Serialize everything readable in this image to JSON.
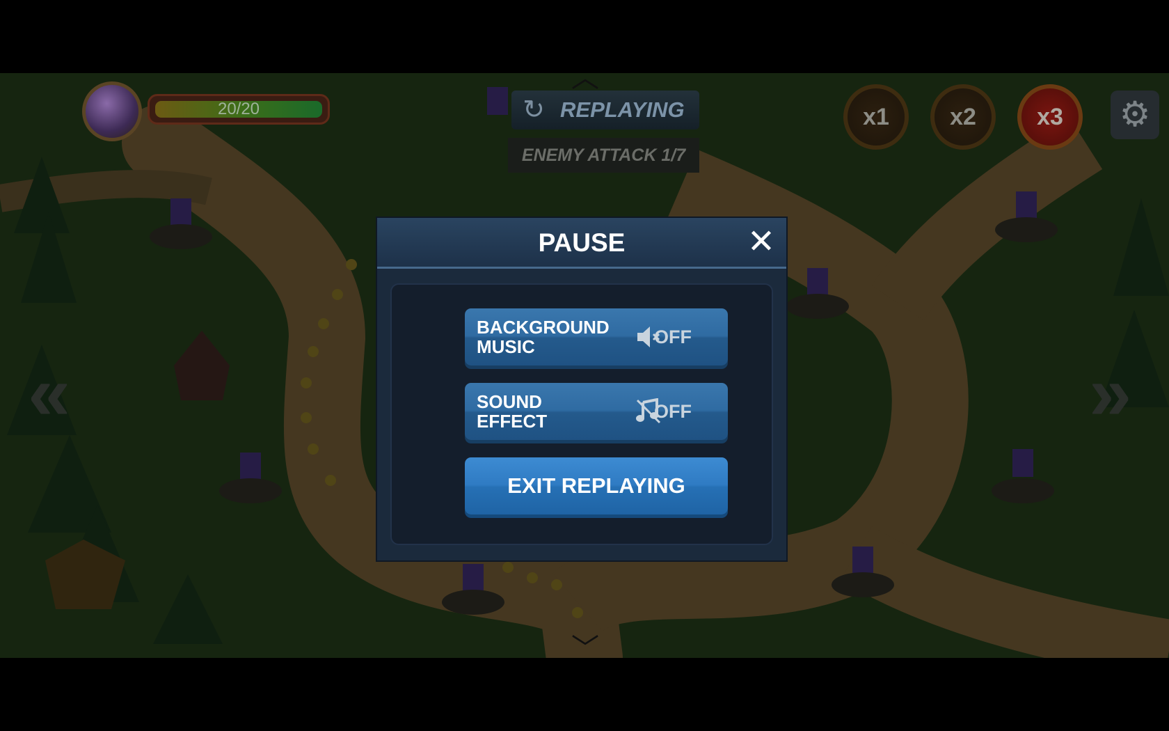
{
  "hud": {
    "castle_hp": "20/20",
    "replay_label": "REPLAYING",
    "enemy_attack": "ENEMY ATTACK 1/7",
    "speeds": [
      "x1",
      "x2",
      "x3"
    ],
    "active_speed": "x3"
  },
  "dialog": {
    "title": "PAUSE",
    "background_music": {
      "line1": "BACKGROUND",
      "line2": "MUSIC",
      "state": "OFF"
    },
    "sound_effect": {
      "line1": "SOUND",
      "line2": "EFFECT",
      "state": "OFF"
    },
    "exit_label": "EXIT REPLAYING"
  },
  "colors": {
    "panel": "#1b2a3c",
    "button": "#2f6ba2",
    "exit_button": "#2f7bc3",
    "active_speed": "#7a1510"
  }
}
